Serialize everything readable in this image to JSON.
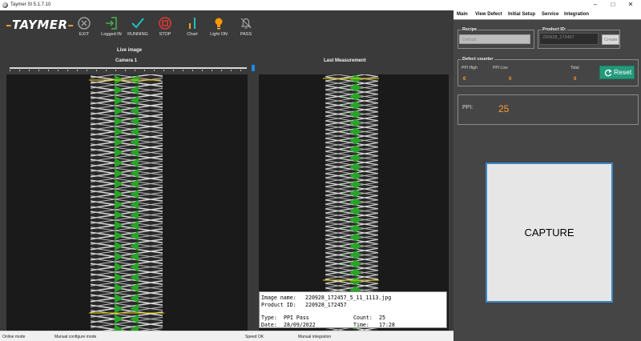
{
  "window": {
    "title": "Taymer SI 5.1.7.10"
  },
  "toolbar": {
    "logo": "TAYMER",
    "buttons": [
      {
        "label": "EXIT",
        "icon": "exit-icon"
      },
      {
        "label": "Logged IN",
        "icon": "login-icon"
      },
      {
        "label": "RUNNING",
        "icon": "check-icon"
      },
      {
        "label": "STOP",
        "icon": "stop-icon"
      },
      {
        "label": "Chart",
        "icon": "chart-icon"
      },
      {
        "label": "Light ON",
        "icon": "bulb-icon"
      },
      {
        "label": "PASS",
        "icon": "bell-off-icon"
      }
    ],
    "colors": {
      "exit": "#9e9e9e",
      "login": "#4caf50",
      "running": "#1ec1c1",
      "stop": "#e53935",
      "chart": "#f5a623",
      "bulb": "#ff9800",
      "bell": "#9e9e9e"
    }
  },
  "live": {
    "title": "Live image",
    "camera_label": "Camera 1"
  },
  "last": {
    "title": "Last Measurement",
    "image_name_label": "Image name:",
    "image_name": "220928_172457_5_11_1113.jpg",
    "product_label": "Product ID:",
    "product_id": "220928_172457",
    "type_label": "Type:",
    "type": "PPI Pass",
    "count_label": "Count:",
    "count": "25",
    "date_label": "Date:",
    "date": "28/09/2022",
    "time_label": "Time:",
    "time": "17:28"
  },
  "status": {
    "mode": "Online mode",
    "config": "Manual configure mode",
    "speed": "Speed OK",
    "integration": "Manual integration"
  },
  "tabs": [
    "Main",
    "View Defect",
    "Initial Setup",
    "Service",
    "Integration"
  ],
  "recipe": {
    "label": "Recipe",
    "value": "Default"
  },
  "product": {
    "label": "Product ID:",
    "value": "220928_172457",
    "create_label": "Create"
  },
  "defects": {
    "label": "Defect counter",
    "ppi_high_label": "PPI High",
    "ppi_high": "0",
    "ppi_low_label": "PPI Low",
    "ppi_low": "0",
    "total_label": "Total",
    "total": "0",
    "reset_label": "Reset"
  },
  "ppi": {
    "label": "PPI:",
    "value": "25"
  },
  "capture_label": "CAPTURE"
}
